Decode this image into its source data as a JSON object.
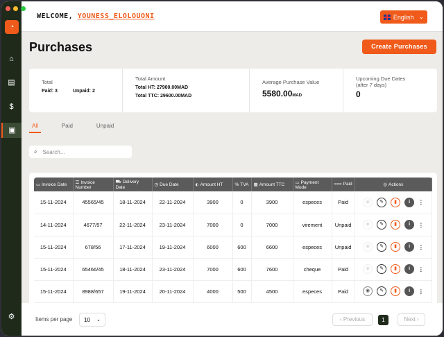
{
  "header": {
    "welcome": "WELCOME,",
    "user": "YOUNESS_ELOLOUONI",
    "language": "English"
  },
  "page": {
    "title": "Purchases",
    "create_label": "Create Purchases"
  },
  "stats": {
    "total_label": "Total",
    "paid": "Paid: 3",
    "unpaid": "Unpaid: 2",
    "amount_label": "Total Amount",
    "total_ht": "Total HT: 27900.00MAD",
    "total_ttc": "Total TTC: 29600.00MAD",
    "avg_label": "Average Purchase Value",
    "avg_value": "5580.00",
    "avg_unit": "MAD",
    "due_label": "Upcoming Due Dates",
    "due_sub": "(after 7 days)",
    "due_value": "0"
  },
  "tabs": [
    "All",
    "Paid",
    "Unpaid"
  ],
  "search": {
    "placeholder": "Search..."
  },
  "table": {
    "headers": [
      "Invoice Date",
      "Invoice Number",
      "Delivery Date",
      "Due Date",
      "Amount HT",
      "TVA",
      "Amount TTC",
      "Payment Mode",
      "Paid",
      "Actions"
    ],
    "rows": [
      [
        "15-11-2024",
        "45565/45",
        "18-11-2024",
        "22-11-2024",
        "3900",
        "0",
        "3900",
        "especes",
        "Paid"
      ],
      [
        "14-11-2024",
        "4677/57",
        "22-11-2024",
        "23-11-2024",
        "7000",
        "0",
        "7000",
        "virement",
        "Unpaid"
      ],
      [
        "15-11-2024",
        "678/56",
        "17-11-2024",
        "19-11-2024",
        "6000",
        "600",
        "6600",
        "especes",
        "Unpaid"
      ],
      [
        "15-11-2024",
        "65466/45",
        "18-11-2024",
        "23-11-2024",
        "7000",
        "600",
        "7600",
        "cheque",
        "Paid"
      ],
      [
        "15-11-2024",
        "8988/657",
        "19-11-2024",
        "20-11-2024",
        "4000",
        "500",
        "4500",
        "especes",
        "Paid"
      ]
    ]
  },
  "footer": {
    "items_per_page": "Items per page",
    "per_page_value": "10",
    "previous": "Previous",
    "page": "1",
    "next": "Next"
  },
  "colors": {
    "accent": "#f05a1a",
    "sidebar": "#1f2a1b",
    "table_header": "#5b5b5b"
  }
}
